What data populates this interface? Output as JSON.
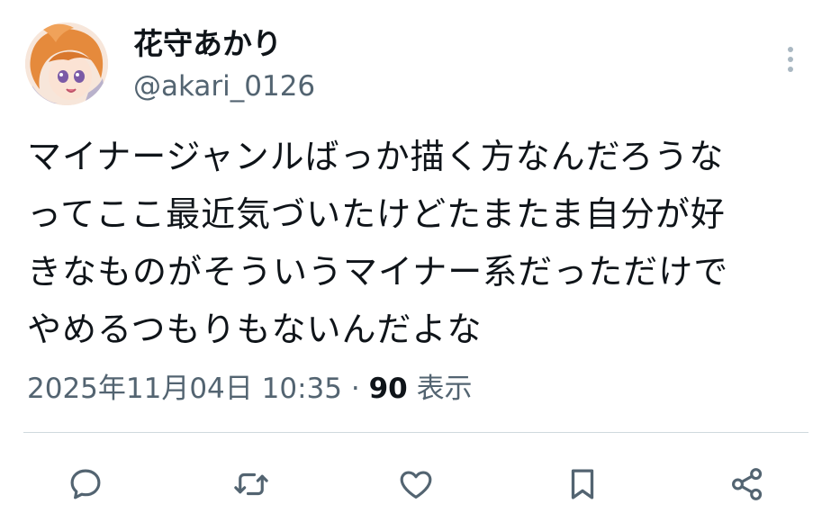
{
  "user": {
    "display_name": "花守あかり",
    "handle": "@akari_0126"
  },
  "tweet": {
    "lines": [
      "マイナージャンルばっか描く方なんだろうな",
      "ってここ最近気づいたけどたまたま自分が好",
      "きなものがそういうマイナー系だっただけで",
      "やめるつもりもないんだよな"
    ],
    "timestamp": "2025年11月04日 10:35",
    "separator": "·",
    "views_count": "90",
    "views_label": "表示"
  },
  "actions": [
    {
      "name": "reply",
      "icon": "reply-icon"
    },
    {
      "name": "retweet",
      "icon": "retweet-icon"
    },
    {
      "name": "like",
      "icon": "heart-icon"
    },
    {
      "name": "bookmark",
      "icon": "bookmark-icon"
    },
    {
      "name": "share",
      "icon": "share-icon"
    }
  ],
  "colors": {
    "text": "#0f1419",
    "secondary": "#536471",
    "divider": "#cfd9de"
  }
}
